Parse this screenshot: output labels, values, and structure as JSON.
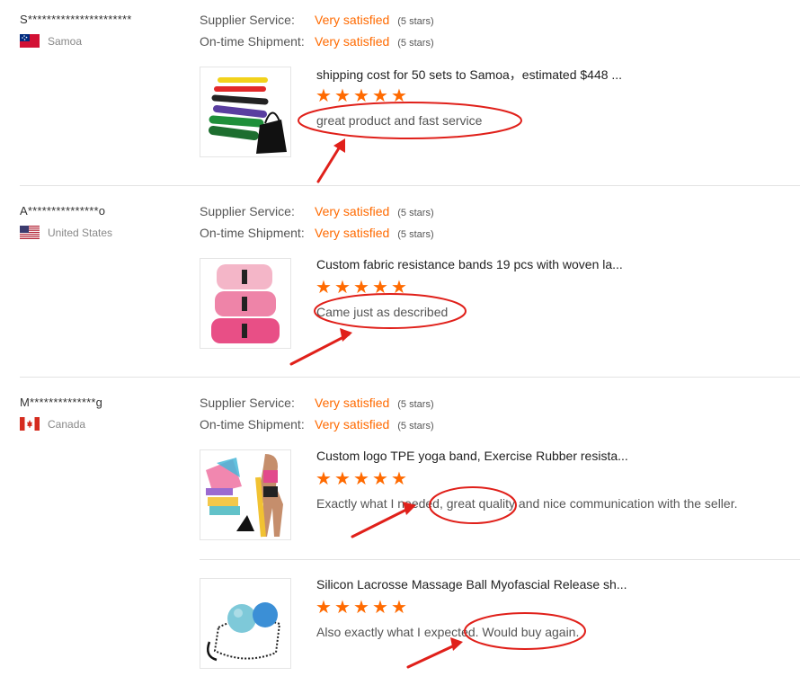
{
  "reviews": [
    {
      "buyer": "S**********************",
      "country": "Samoa",
      "flag_colors": {
        "field": "#d21034",
        "canton": "#002b7f"
      },
      "ratings": [
        {
          "label": "Supplier Service:",
          "value": "Very satisfied",
          "stars": "(5 stars)"
        },
        {
          "label": "On-time Shipment:",
          "value": "Very satisfied",
          "stars": "(5 stars)"
        }
      ],
      "items": [
        {
          "title": "shipping cost for 50 sets to Samoa，estimated $448 ...",
          "stars": 5,
          "comment": "great product and fast service",
          "image_icon": "resistance-bands-icon"
        }
      ]
    },
    {
      "buyer": "A***************o",
      "country": "United States",
      "flag_colors": {
        "stripe": "#b22234",
        "canton": "#3c3b6e"
      },
      "ratings": [
        {
          "label": "Supplier Service:",
          "value": "Very satisfied",
          "stars": "(5 stars)"
        },
        {
          "label": "On-time Shipment:",
          "value": "Very satisfied",
          "stars": "(5 stars)"
        }
      ],
      "items": [
        {
          "title": "Custom fabric resistance bands 19 pcs with woven la...",
          "stars": 5,
          "comment": "Came just as described",
          "image_icon": "fabric-bands-icon"
        }
      ]
    },
    {
      "buyer": "M**************g",
      "country": "Canada",
      "flag_colors": {
        "field": "#d52b1e"
      },
      "ratings": [
        {
          "label": "Supplier Service:",
          "value": "Very satisfied",
          "stars": "(5 stars)"
        },
        {
          "label": "On-time Shipment:",
          "value": "Very satisfied",
          "stars": "(5 stars)"
        }
      ],
      "items": [
        {
          "title": "Custom logo TPE yoga band, Exercise Rubber resista...",
          "stars": 5,
          "comment": "Exactly what I needed, great quality and nice communication with the seller.",
          "image_icon": "yoga-band-icon"
        },
        {
          "title": "Silicon Lacrosse Massage Ball Myofascial Release sh...",
          "stars": 5,
          "comment": "Also exactly what I expected. Would buy again.",
          "image_icon": "massage-ball-icon"
        }
      ]
    }
  ],
  "colors": {
    "accent": "#ff6a00",
    "annotation": "#e0201a"
  }
}
